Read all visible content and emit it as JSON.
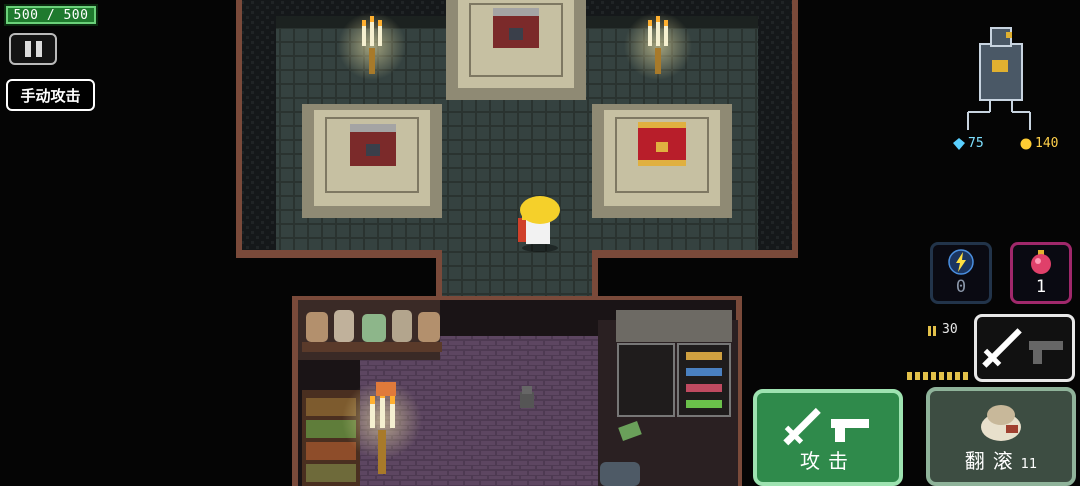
{
  "hud": {
    "hp_text": "500 / 500",
    "manual_attack_label": "手动攻击",
    "gems": "75",
    "gold": "140"
  },
  "skill_slot": {
    "count": "0"
  },
  "potion_slot": {
    "count": "1"
  },
  "ammo": {
    "count": "30"
  },
  "buttons": {
    "attack_label": "攻击",
    "roll_label": "翻滚",
    "roll_count": "11"
  },
  "colors": {
    "attack_button": "#2f8a4b",
    "roll_button": "#3d4d42",
    "potion_border": "#a0286b",
    "hp_bar": "#1f7a2e"
  }
}
